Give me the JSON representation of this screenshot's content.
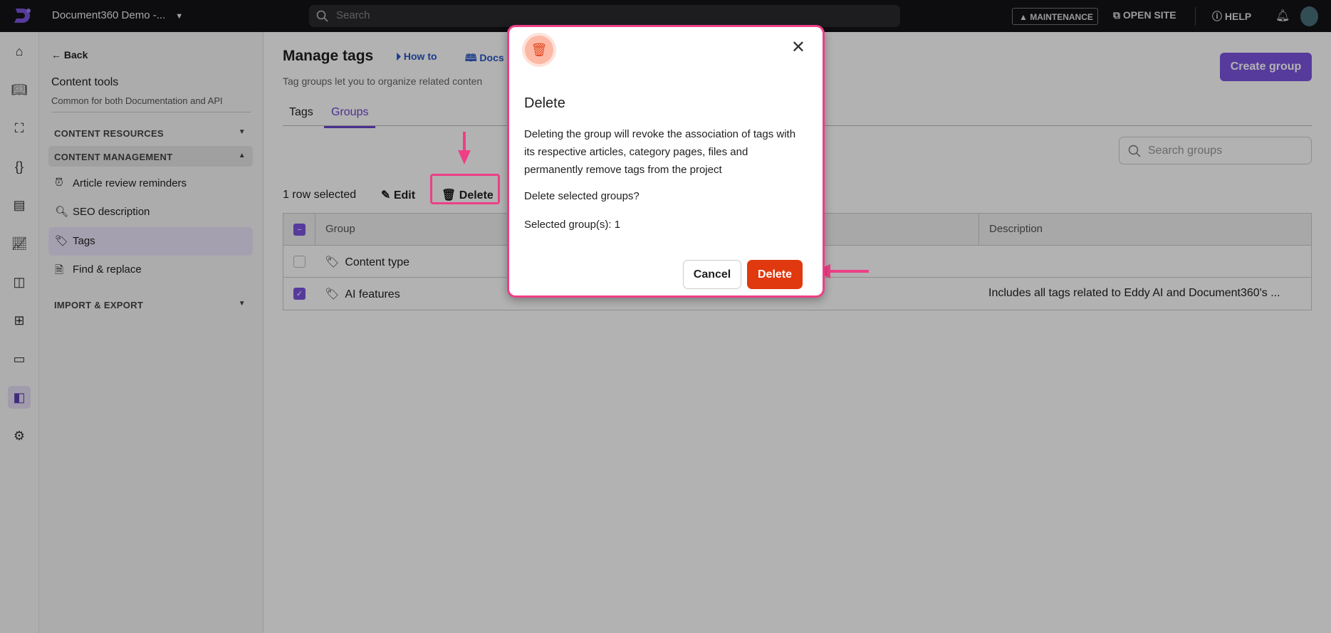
{
  "topbar": {
    "project": "Document360 Demo -...",
    "search_placeholder": "Search",
    "maintenance": "MAINTENANCE",
    "open_site": "OPEN SITE",
    "help": "HELP"
  },
  "sidebar": {
    "back": "Back",
    "title": "Content tools",
    "subtitle": "Common for both Documentation and API",
    "sections": {
      "resources": "CONTENT RESOURCES",
      "management": "CONTENT MANAGEMENT",
      "import_export": "IMPORT & EXPORT"
    },
    "items": [
      {
        "label": "Article review reminders"
      },
      {
        "label": "SEO description"
      },
      {
        "label": "Tags",
        "active": true
      },
      {
        "label": "Find & replace"
      }
    ]
  },
  "main": {
    "title": "Manage tags",
    "how_to": "How to",
    "docs": "Docs",
    "subtitle": "Tag groups let you to organize related conten",
    "create_group": "Create group",
    "tabs": [
      {
        "label": "Tags"
      },
      {
        "label": "Groups",
        "active": true
      }
    ],
    "search_placeholder": "Search groups",
    "toolbar": {
      "selected": "1 row selected",
      "edit": "Edit",
      "delete": "Delete"
    },
    "table": {
      "columns": [
        "Group",
        "Description"
      ],
      "rows": [
        {
          "group": "Content type",
          "description": "",
          "checked": false
        },
        {
          "group": "AI features",
          "description": "Includes all tags related to Eddy AI and Document360's ...",
          "checked": true
        }
      ]
    }
  },
  "modal": {
    "title": "Delete",
    "body": "Deleting the group will revoke the association of tags with its respective articles, category pages, files and permanently remove tags from the project",
    "question": "Delete selected groups?",
    "count": "Selected group(s): 1",
    "cancel": "Cancel",
    "confirm": "Delete"
  },
  "colors": {
    "accent": "#7c55e0",
    "danger": "#e0380f",
    "highlight": "#ee3f86"
  }
}
